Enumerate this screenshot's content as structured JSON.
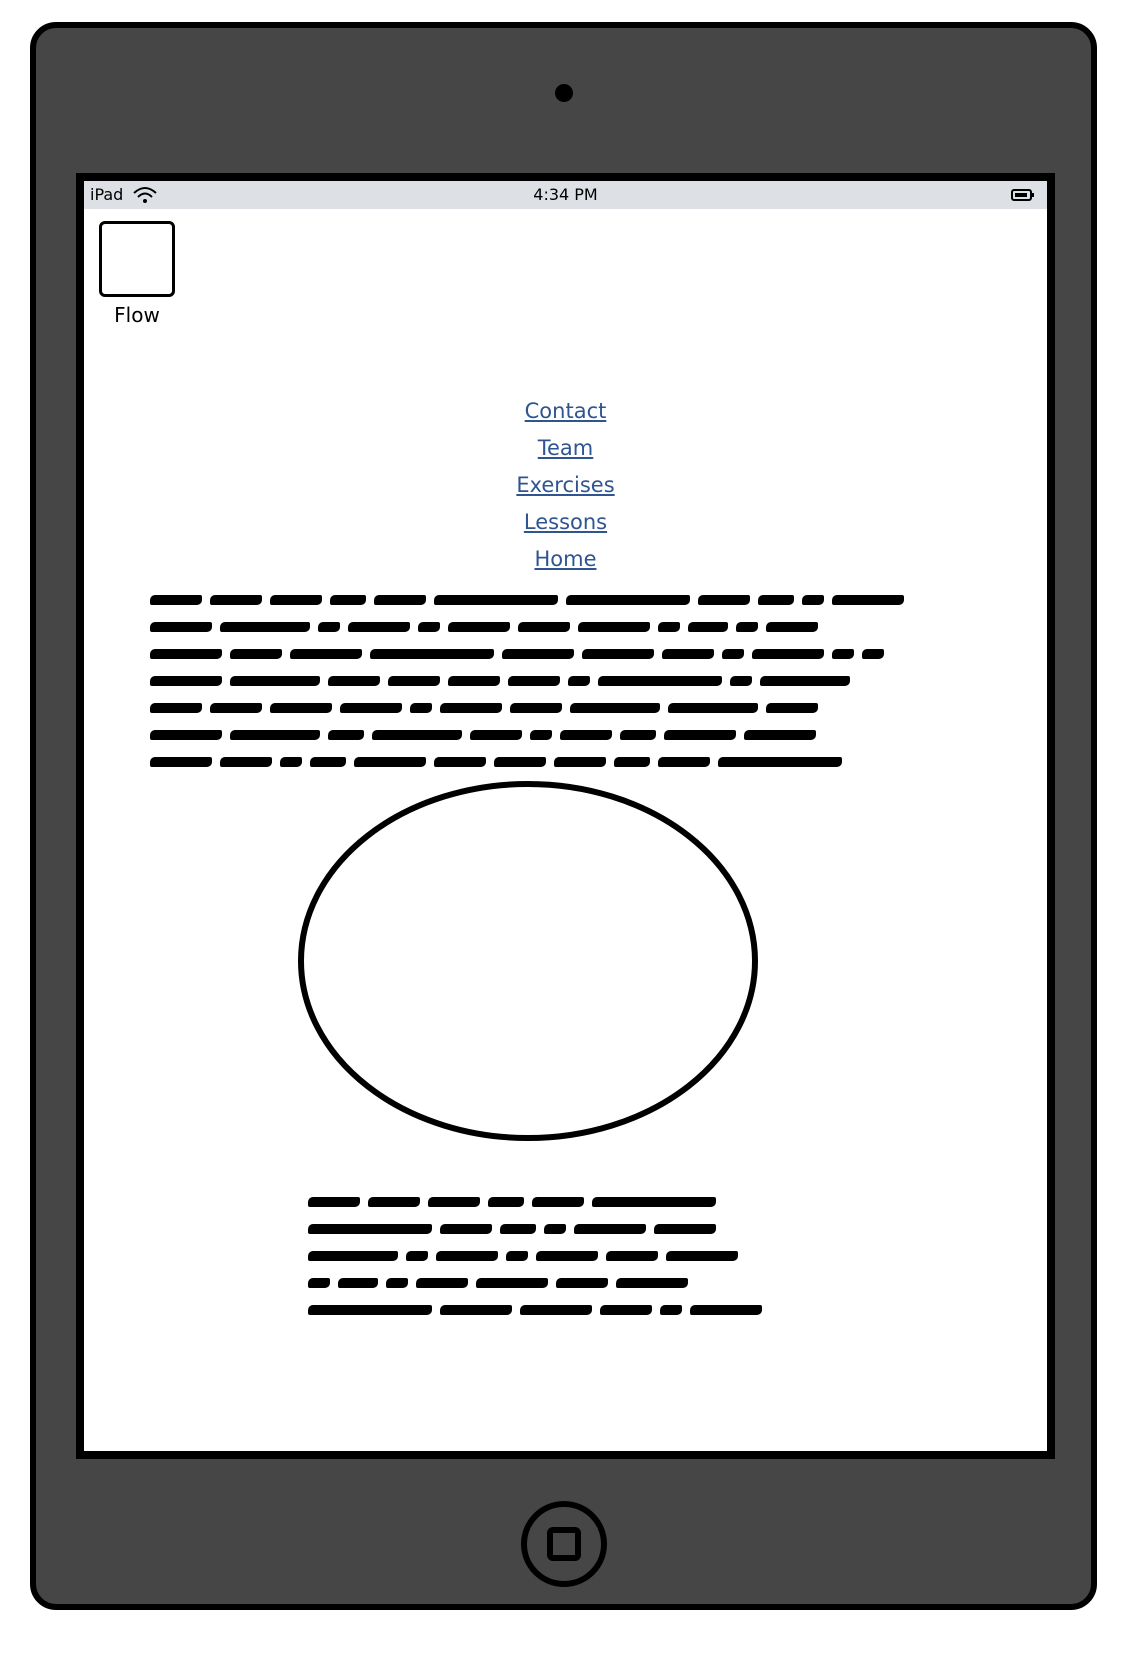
{
  "device": {
    "name": "iPad",
    "time": "4:34 PM"
  },
  "flow": {
    "label": "Flow"
  },
  "nav": {
    "items": [
      {
        "label": "Contact"
      },
      {
        "label": "Team"
      },
      {
        "label": "Exercises"
      },
      {
        "label": "Lessons"
      },
      {
        "label": "Home"
      }
    ]
  },
  "colors": {
    "device_body": "#464646",
    "status_bar": "#dde1e5",
    "link": "#2f5591"
  },
  "icons": {
    "wifi": "wifi-icon",
    "battery": "battery-icon",
    "camera": "camera-icon",
    "home_button": "home-button-icon",
    "image_placeholder": "image-placeholder-icon"
  }
}
